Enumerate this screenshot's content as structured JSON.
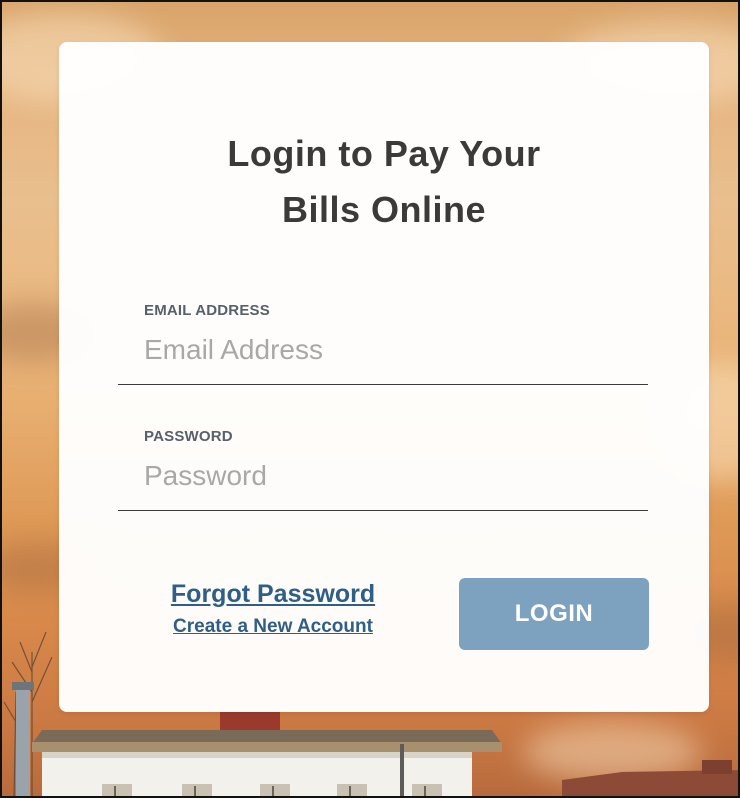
{
  "login_card": {
    "title_line1": "Login to Pay Your",
    "title_line2": "Bills Online"
  },
  "email": {
    "label": "EMAIL ADDRESS",
    "placeholder": "Email Address",
    "value": ""
  },
  "password": {
    "label": "PASSWORD",
    "placeholder": "Password",
    "value": ""
  },
  "links": {
    "forgot_password": "Forgot Password",
    "create_account": "Create a New Account"
  },
  "login_button": {
    "label": "LOGIN"
  },
  "colors": {
    "accent_link": "#2f5f86",
    "button_bg": "#7ca2c0",
    "title_text": "#3a3a3a"
  }
}
